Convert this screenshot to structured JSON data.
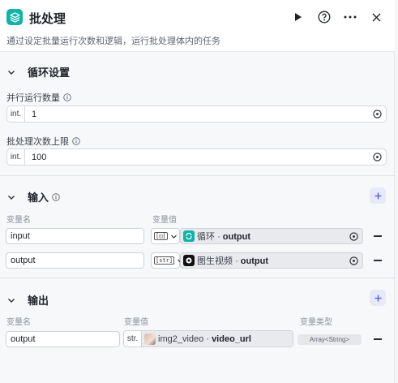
{
  "header": {
    "title": "批处理",
    "description": "通过设定批量运行次数和逻辑，运行批处理体内的任务",
    "icon": "batch-stack-icon",
    "accent": "#10b3a7"
  },
  "loop_settings": {
    "title": "循环设置",
    "parallel": {
      "label": "并行运行数量",
      "type": "int.",
      "value": "1"
    },
    "limit": {
      "label": "批处理次数上限",
      "type": "int.",
      "value": "100"
    }
  },
  "inputs": {
    "title": "输入",
    "col_name": "变量名",
    "col_value": "变量值",
    "rows": [
      {
        "name": "input",
        "type_icon": "[◫]",
        "node": "循环",
        "field": "output",
        "node_color": "#10b3a7"
      },
      {
        "name": "output",
        "type_icon": "[str]",
        "node": "图生视频",
        "field": "output",
        "node_color": "#111111"
      }
    ]
  },
  "outputs": {
    "title": "输出",
    "col_name": "变量名",
    "col_value": "变量值",
    "col_type": "变量类型",
    "rows": [
      {
        "name": "output",
        "type": "str.",
        "node": "img2_video",
        "sep": "·",
        "field": "video_url",
        "var_type": "Array<String>"
      }
    ]
  },
  "sep": "·"
}
